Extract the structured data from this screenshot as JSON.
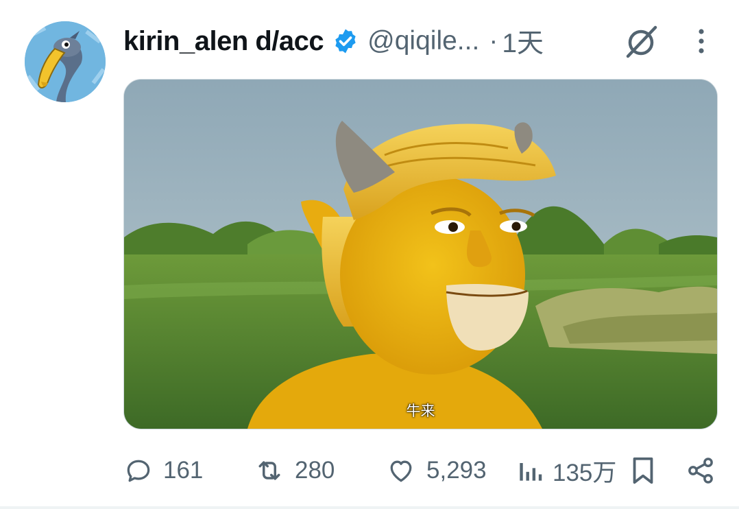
{
  "tweet": {
    "display_name": "kirin_alen d/acc",
    "handle": "@qiqile...",
    "separator": "·",
    "time": "1天",
    "verified": true,
    "media_subtitle": "牛来"
  },
  "actions": {
    "replies": "161",
    "reposts": "280",
    "likes": "5,293",
    "views": "135万"
  },
  "icons": {
    "reply": "speech-bubble",
    "repost": "repost-arrows",
    "like": "heart",
    "views": "bar-chart",
    "bookmark": "bookmark",
    "share": "share-nodes",
    "grok": "grok-slash-circle",
    "more": "vertical-dots"
  },
  "colors": {
    "verified_blue": "#1d9bf0",
    "text_primary": "#0f1419",
    "text_secondary": "#536471"
  }
}
